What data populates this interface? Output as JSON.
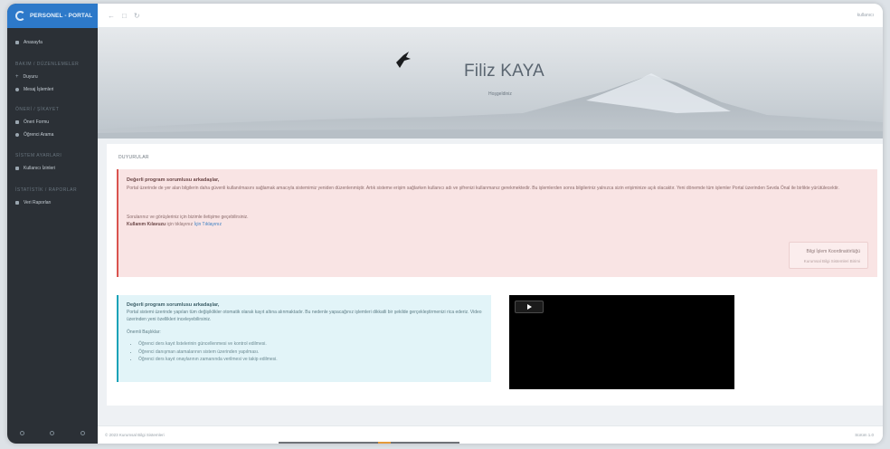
{
  "app": {
    "brand": "PERSONEL - PORTAL"
  },
  "topbar": {
    "user": "kullanıcı"
  },
  "sidebar": {
    "sections": [
      {
        "title": "",
        "items": [
          {
            "label": "Anasayfa",
            "icon": "home-icon"
          }
        ]
      },
      {
        "title": "BAKIM / DÜZENLEMELER",
        "items": [
          {
            "label": "Duyuru",
            "icon": "plus-icon"
          },
          {
            "label": "Mesaj İşlemleri",
            "icon": "user-icon"
          }
        ]
      },
      {
        "title": "ÖNERİ / ŞİKAYET",
        "items": [
          {
            "label": "Öneri Formu",
            "icon": "form-icon"
          },
          {
            "label": "Öğrenci Arama",
            "icon": "search-icon"
          }
        ]
      },
      {
        "title": "SİSTEM AYARLARI",
        "items": [
          {
            "label": "Kullanıcı İzinleri",
            "icon": "key-icon"
          }
        ]
      },
      {
        "title": "İSTATİSTİK / RAPORLAR",
        "items": [
          {
            "label": "Veri Raporları",
            "icon": "chart-icon"
          }
        ]
      }
    ]
  },
  "hero": {
    "name": "Filiz KAYA",
    "role": "Hoşgeldiniz"
  },
  "main": {
    "card_title": "DUYURULAR",
    "danger": {
      "heading": "Değerli program sorumlusu arkadaşlar,",
      "paragraph1": "Portal üzerinde de yer alan bilgilerin daha güvenli kullanılmasını sağlamak amacıyla sistemimiz yeniden düzenlenmiştir. Artık sisteme erişim sağlarken kullanıcı adı ve şifrenizi kullanmanız gerekmektedir. Bu işlemlerden sonra bilgileriniz yalnızca sizin erişiminize açık olacaktır. Yeni dönemde tüm işlemler Portal üzerinden Sevda Önal ile birlikte yürütülecektir.",
      "paragraph2": "Sorularınız ve görüşleriniz için bizimle iletişime geçebilirsiniz.",
      "paragraph3_bold": "Kullanım Kılavuzu",
      "paragraph3_text": " için tıklayınız ",
      "paragraph3_link": "İçin Tıklayınız",
      "sign_line1": "Bilgi İşlem Koordinatörlüğü",
      "sign_line2": "Kurumsal Bilgi Sistemleri Birimi"
    },
    "info": {
      "heading": "Değerli program sorumlusu arkadaşlar,",
      "paragraph1": "Portal sistemi üzerinde yapılan tüm değişiklikler otomatik olarak kayıt altına alınmaktadır. Bu nedenle yapacağınız işlemleri dikkatli bir şekilde gerçekleştirmenizi rica ederiz. Video üzerinden yeni özellikleri inceleyebilirsiniz.",
      "paragraph2": "Önemli Başlıklar:",
      "items": [
        "Öğrenci ders kayıt listelerinin güncellenmesi ve kontrol edilmesi.",
        "Öğrenci danışman atamalarının sistem üzerinden yapılması.",
        "Öğrenci ders kayıt onaylarının zamanında verilmesi ve takip edilmesi."
      ]
    }
  },
  "footer": {
    "left": "© 2023 Kurumsal Bilgi Sistemleri",
    "right": "Sürüm 1.0"
  }
}
